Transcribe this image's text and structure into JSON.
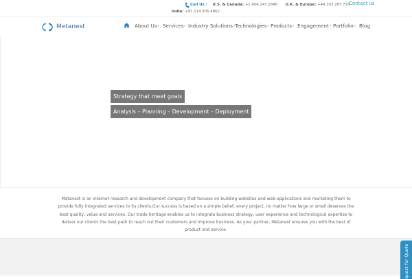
{
  "topbar": {
    "call_label": "Call Us :",
    "phones": [
      {
        "region": "U.S. & Canada:",
        "number": "+1.404.247.2848"
      },
      {
        "region": "U.K. & Europe:",
        "number": "+44.203.287.728"
      },
      {
        "region": "India:",
        "number": "+91.114.305.4862"
      }
    ],
    "contact_label": "Contact us"
  },
  "header": {
    "logo_text": "Metanest",
    "nav": [
      {
        "label": "About Us",
        "has_dropdown": true
      },
      {
        "label": "Services",
        "has_dropdown": true
      },
      {
        "label": "Industry Solutions",
        "has_dropdown": true
      },
      {
        "label": "Technologies",
        "has_dropdown": true
      },
      {
        "label": "Products",
        "has_dropdown": true
      },
      {
        "label": "Engagement",
        "has_dropdown": true
      },
      {
        "label": "Portfolio",
        "has_dropdown": true
      },
      {
        "label": "Blog",
        "has_dropdown": false
      }
    ]
  },
  "hero": {
    "headline": "Strategy that meet goals",
    "subline": "Analysis – Planning – Development – Deployment"
  },
  "about": {
    "text": "Metanest is an internet research and development company that focuses on building websites and web-applications and marketing them to provide fully integrated services to its clients.Our success is based on a simple belief; every project, no matter how large or small deserves the best quality, value and services. Our trade heritage enables us to integrate business strategy, user experience and technological expertise to deliver our clients the best path to reach out their customers and improve business. As your partner, Metanest ensures you with the best of product and service."
  },
  "quote_tab": {
    "label": "Request for Quote"
  },
  "colors": {
    "accent": "#2d8fc4",
    "banner": "#777777",
    "footer": "#f2f2f2"
  }
}
